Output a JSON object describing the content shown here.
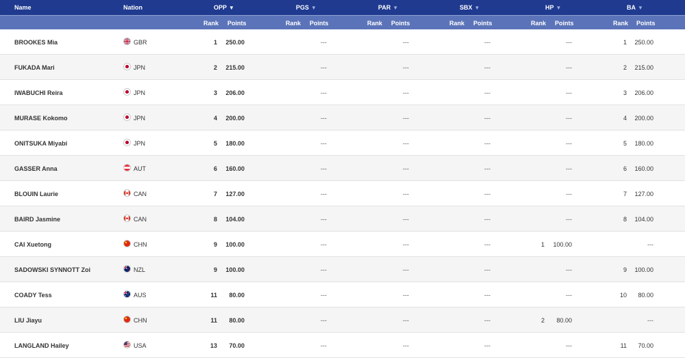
{
  "header": {
    "name": "Name",
    "nation": "Nation",
    "disciplines": [
      {
        "label": "OPP",
        "active": true
      },
      {
        "label": "PGS",
        "active": false
      },
      {
        "label": "PAR",
        "active": false
      },
      {
        "label": "SBX",
        "active": false
      },
      {
        "label": "HP",
        "active": false
      },
      {
        "label": "BA",
        "active": false
      }
    ],
    "rank_label": "Rank",
    "points_label": "Points",
    "sort_icon": "triangle-down"
  },
  "rows": [
    {
      "name": "BROOKES Mia",
      "nation": "GBR",
      "flag": "gbr",
      "opp_rank": "1",
      "opp_points": "250.00",
      "pgs": "---",
      "par": "---",
      "sbx": "---",
      "hp_rank": "",
      "hp_points": "---",
      "ba_rank": "1",
      "ba_points": "250.00"
    },
    {
      "name": "FUKADA Mari",
      "nation": "JPN",
      "flag": "jpn",
      "opp_rank": "2",
      "opp_points": "215.00",
      "pgs": "---",
      "par": "---",
      "sbx": "---",
      "hp_rank": "",
      "hp_points": "---",
      "ba_rank": "2",
      "ba_points": "215.00"
    },
    {
      "name": "IWABUCHI Reira",
      "nation": "JPN",
      "flag": "jpn",
      "opp_rank": "3",
      "opp_points": "206.00",
      "pgs": "---",
      "par": "---",
      "sbx": "---",
      "hp_rank": "",
      "hp_points": "---",
      "ba_rank": "3",
      "ba_points": "206.00"
    },
    {
      "name": "MURASE Kokomo",
      "nation": "JPN",
      "flag": "jpn",
      "opp_rank": "4",
      "opp_points": "200.00",
      "pgs": "---",
      "par": "---",
      "sbx": "---",
      "hp_rank": "",
      "hp_points": "---",
      "ba_rank": "4",
      "ba_points": "200.00"
    },
    {
      "name": "ONITSUKA Miyabi",
      "nation": "JPN",
      "flag": "jpn",
      "opp_rank": "5",
      "opp_points": "180.00",
      "pgs": "---",
      "par": "---",
      "sbx": "---",
      "hp_rank": "",
      "hp_points": "---",
      "ba_rank": "5",
      "ba_points": "180.00"
    },
    {
      "name": "GASSER Anna",
      "nation": "AUT",
      "flag": "aut",
      "opp_rank": "6",
      "opp_points": "160.00",
      "pgs": "---",
      "par": "---",
      "sbx": "---",
      "hp_rank": "",
      "hp_points": "---",
      "ba_rank": "6",
      "ba_points": "160.00"
    },
    {
      "name": "BLOUIN Laurie",
      "nation": "CAN",
      "flag": "can",
      "opp_rank": "7",
      "opp_points": "127.00",
      "pgs": "---",
      "par": "---",
      "sbx": "---",
      "hp_rank": "",
      "hp_points": "---",
      "ba_rank": "7",
      "ba_points": "127.00"
    },
    {
      "name": "BAIRD Jasmine",
      "nation": "CAN",
      "flag": "can",
      "opp_rank": "8",
      "opp_points": "104.00",
      "pgs": "---",
      "par": "---",
      "sbx": "---",
      "hp_rank": "",
      "hp_points": "---",
      "ba_rank": "8",
      "ba_points": "104.00"
    },
    {
      "name": "CAI Xuetong",
      "nation": "CHN",
      "flag": "chn",
      "opp_rank": "9",
      "opp_points": "100.00",
      "pgs": "---",
      "par": "---",
      "sbx": "---",
      "hp_rank": "1",
      "hp_points": "100.00",
      "ba_rank": "",
      "ba_points": "---"
    },
    {
      "name": "SADOWSKI SYNNOTT Zoi",
      "nation": "NZL",
      "flag": "nzl",
      "opp_rank": "9",
      "opp_points": "100.00",
      "pgs": "---",
      "par": "---",
      "sbx": "---",
      "hp_rank": "",
      "hp_points": "---",
      "ba_rank": "9",
      "ba_points": "100.00"
    },
    {
      "name": "COADY Tess",
      "nation": "AUS",
      "flag": "aus",
      "opp_rank": "11",
      "opp_points": "80.00",
      "pgs": "---",
      "par": "---",
      "sbx": "---",
      "hp_rank": "",
      "hp_points": "---",
      "ba_rank": "10",
      "ba_points": "80.00"
    },
    {
      "name": "LIU Jiayu",
      "nation": "CHN",
      "flag": "chn",
      "opp_rank": "11",
      "opp_points": "80.00",
      "pgs": "---",
      "par": "---",
      "sbx": "---",
      "hp_rank": "2",
      "hp_points": "80.00",
      "ba_rank": "",
      "ba_points": "---"
    },
    {
      "name": "LANGLAND Hailey",
      "nation": "USA",
      "flag": "usa",
      "opp_rank": "13",
      "opp_points": "70.00",
      "pgs": "---",
      "par": "---",
      "sbx": "---",
      "hp_rank": "",
      "hp_points": "---",
      "ba_rank": "11",
      "ba_points": "70.00"
    }
  ],
  "colors": {
    "header_dark": "#1f3a8f",
    "header_light": "#5b73b8"
  }
}
